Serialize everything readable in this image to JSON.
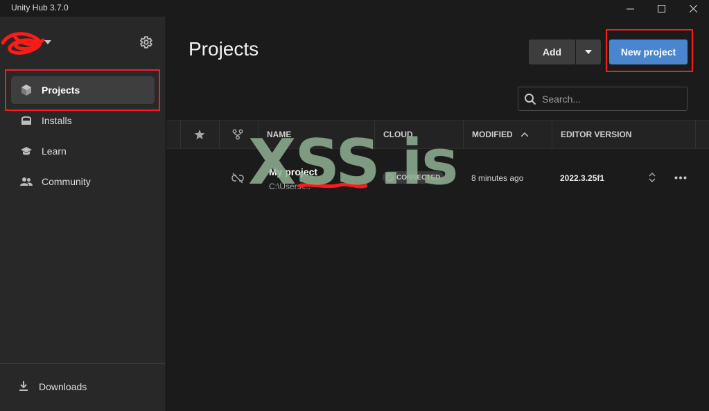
{
  "window": {
    "title": "Unity Hub 3.7.0",
    "controls": [
      "minimize-icon",
      "maximize-icon",
      "close-icon"
    ]
  },
  "sidebar": {
    "items": [
      {
        "label": "Projects",
        "icon": "cube-icon",
        "active": true
      },
      {
        "label": "Installs",
        "icon": "installs-icon",
        "active": false
      },
      {
        "label": "Learn",
        "icon": "graduation-cap-icon",
        "active": false
      },
      {
        "label": "Community",
        "icon": "people-icon",
        "active": false
      }
    ],
    "downloads": {
      "label": "Downloads",
      "icon": "download-icon"
    }
  },
  "main": {
    "title": "Projects",
    "add_label": "Add",
    "new_project_label": "New project",
    "search": {
      "placeholder": "Search...",
      "value": ""
    }
  },
  "table": {
    "columns": [
      "NAME",
      "CLOUD",
      "MODIFIED",
      "EDITOR VERSION"
    ],
    "rows": [
      {
        "name": "My project",
        "path": "C:\\Users\\...",
        "cloud": "CONNECTED",
        "modified": "8 minutes ago",
        "editor_version": "2022.3.25f1"
      }
    ]
  },
  "watermark": "XSS.is",
  "colors": {
    "accent": "#4a86d0",
    "highlight": "#ff1a1a",
    "sidebar_bg": "#282828",
    "main_bg": "#1b1b1b"
  }
}
